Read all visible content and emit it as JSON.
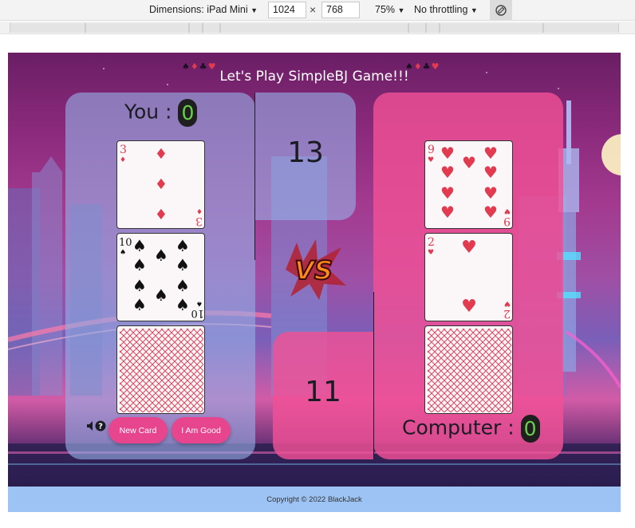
{
  "devtools": {
    "device_label": "Dimensions: iPad Mini",
    "width": "1024",
    "height": "768",
    "times": "×",
    "zoom": "75%",
    "throttling": "No throttling"
  },
  "game": {
    "title": "Let's Play SimpleBJ Game!!!",
    "suits_left": [
      "♠",
      "♦",
      "♣",
      "♥"
    ],
    "suits_right": [
      "♠",
      "♦",
      "♣",
      "♥"
    ],
    "you_label": "You :",
    "you_score": "0",
    "computer_label": "Computer :",
    "computer_score": "0",
    "you_total": "13",
    "computer_total": "11",
    "vs_text": "VS",
    "new_card_button": "New Card",
    "i_am_good_button": "I Am Good",
    "sound_icon": "speaker-icon",
    "help_icon": "help-icon",
    "help_glyph": "?",
    "you_cards": [
      {
        "rank": "3",
        "suit": "♦",
        "suit_name": "diamonds",
        "color": "#e23a4f"
      },
      {
        "rank": "10",
        "suit": "♠",
        "suit_name": "spades",
        "color": "#111111"
      },
      {
        "back": true
      }
    ],
    "computer_cards": [
      {
        "rank": "9",
        "suit": "♥",
        "suit_name": "hearts",
        "color": "#e23a4f"
      },
      {
        "rank": "2",
        "suit": "♥",
        "suit_name": "hearts",
        "color": "#e23a4f"
      },
      {
        "back": true
      }
    ]
  },
  "footer": {
    "copyright": "Copyright © 2022 BlackJack"
  },
  "colors": {
    "button_pink": "#e8458f",
    "panel_blue": "#96afe6",
    "panel_pink": "#f05096",
    "score_green": "#6ad04a",
    "footer_blue": "#9cc3f3"
  }
}
